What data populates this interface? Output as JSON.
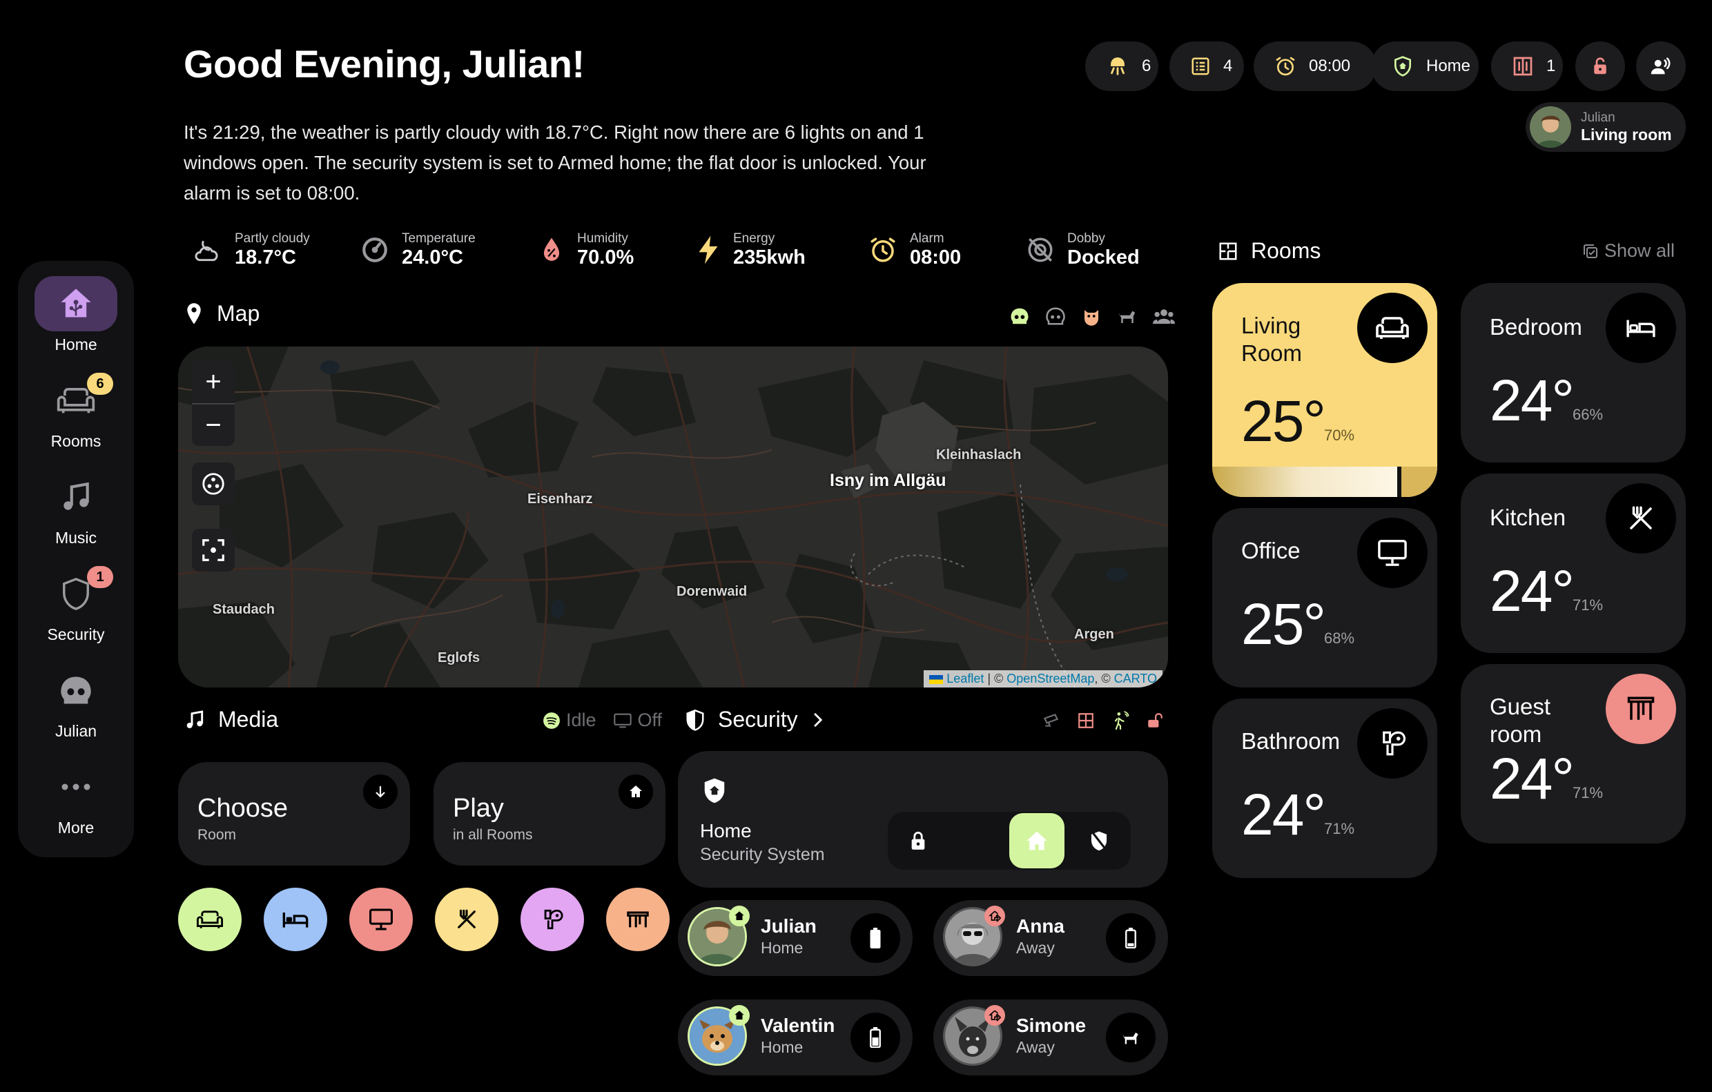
{
  "greeting": "Good Evening, Julian!",
  "summary": "It's 21:29, the weather is partly cloudy with 18.7°C. Right now there are 6 lights on and 1 windows open. The security system is set to Armed home; the flat door is unlocked. Your alarm is set to 08:00.",
  "header_pills": {
    "lights": "6",
    "todos": "4",
    "alarm": "08:00",
    "security": "Home",
    "windows": "1"
  },
  "user": {
    "name": "Julian",
    "location": "Living room"
  },
  "sidebar": {
    "items": [
      {
        "label": "Home",
        "icon": "home-assistant-icon"
      },
      {
        "label": "Rooms",
        "icon": "sofa-icon",
        "badge": "6"
      },
      {
        "label": "Music",
        "icon": "music-note-icon"
      },
      {
        "label": "Security",
        "icon": "shield-icon",
        "badge": "1"
      },
      {
        "label": "Julian",
        "icon": "robot-icon"
      },
      {
        "label": "More",
        "icon": "dots-icon"
      }
    ]
  },
  "stats": [
    {
      "label": "Partly cloudy",
      "value": "18.7°C",
      "icon": "weather-partly-cloudy-night-icon"
    },
    {
      "label": "Temperature",
      "value": "24.0°C",
      "icon": "thermostat-icon"
    },
    {
      "label": "Humidity",
      "value": "70.0%",
      "icon": "water-percent-icon"
    },
    {
      "label": "Energy",
      "value": "235kwh",
      "icon": "lightning-icon"
    },
    {
      "label": "Alarm",
      "value": "08:00",
      "icon": "alarm-icon"
    },
    {
      "label": "Dobby",
      "value": "Docked",
      "icon": "robot-vacuum-off-icon"
    }
  ],
  "map": {
    "title": "Map",
    "labels": [
      "Kleinhaslach",
      "Isny im Allgäu",
      "Eisenharz",
      "Dorenwaid",
      "Staudach",
      "Eglofs",
      "Argen"
    ],
    "attribution_leaflet": "Leaflet",
    "attribution_sep1": " | © ",
    "attribution_osm": "OpenStreetMap",
    "attribution_sep2": ", © ",
    "attribution_carto": "CARTO",
    "zoom_in": "+",
    "zoom_out": "−"
  },
  "media": {
    "title": "Media",
    "status_spotify": "Idle",
    "status_tv": "Off",
    "choose_title": "Choose",
    "choose_sub": "Room",
    "play_title": "Play",
    "play_sub": "in all Rooms",
    "room_colors": [
      "#d4f5a0",
      "#9fc3f7",
      "#f08e89",
      "#fbe08f",
      "#e3a6f2",
      "#f7b28a"
    ]
  },
  "security": {
    "title": "Security",
    "mode": "Home",
    "system": "Security System",
    "active_color": "#d4f5a0"
  },
  "people": [
    {
      "name": "Julian",
      "state": "Home"
    },
    {
      "name": "Anna",
      "state": "Away"
    },
    {
      "name": "Valentin",
      "state": "Home"
    },
    {
      "name": "Simone",
      "state": "Away"
    }
  ],
  "rooms": {
    "title": "Rooms",
    "show_all": "Show all",
    "items": [
      {
        "name": "Living Room",
        "temp": "25°",
        "humidity": "70%",
        "icon": "sofa-icon",
        "active": true,
        "accent": "#f9d97b"
      },
      {
        "name": "Bedroom",
        "temp": "24°",
        "humidity": "66%",
        "icon": "bed-icon"
      },
      {
        "name": "Office",
        "temp": "25°",
        "humidity": "68%",
        "icon": "monitor-icon"
      },
      {
        "name": "Kitchen",
        "temp": "24°",
        "humidity": "71%",
        "icon": "silverware-icon"
      },
      {
        "name": "Bathroom",
        "temp": "24°",
        "humidity": "71%",
        "icon": "toilet-icon"
      },
      {
        "name": "Guest room",
        "temp": "24°",
        "humidity": "71%",
        "icon": "window-open-icon",
        "accent": "#f08e89"
      }
    ]
  }
}
